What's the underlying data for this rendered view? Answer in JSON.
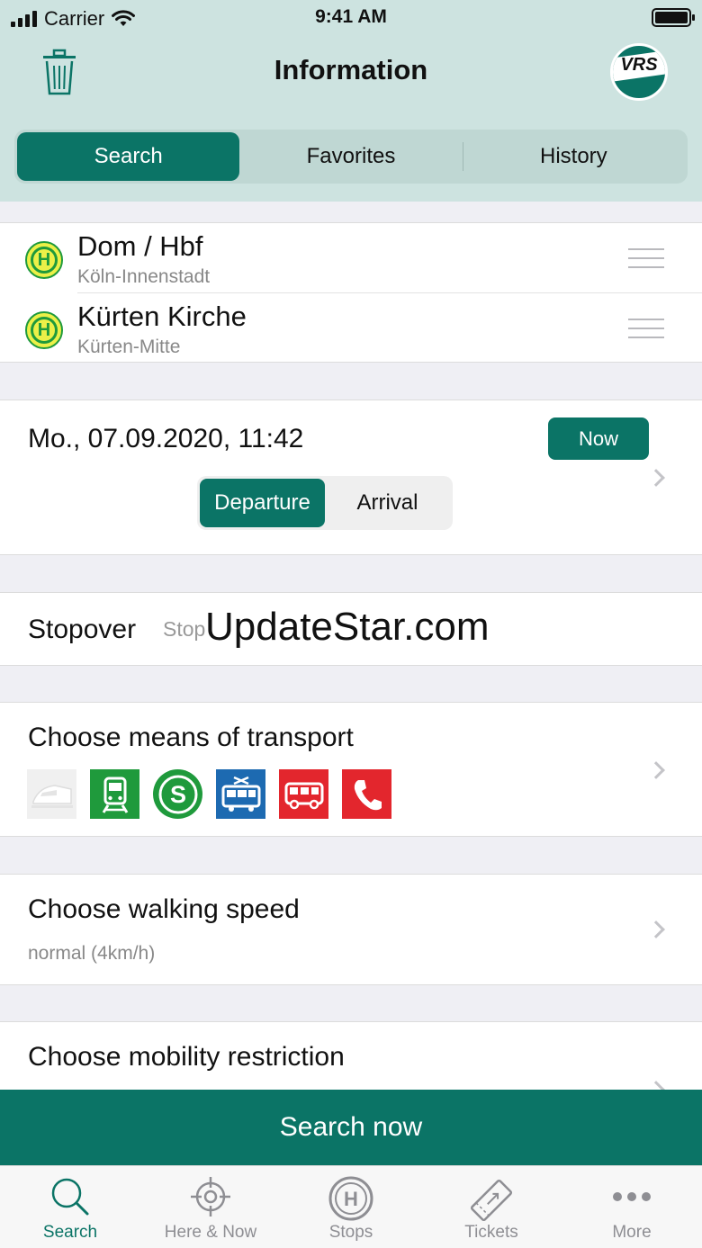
{
  "status_bar": {
    "carrier": "Carrier",
    "time": "9:41 AM"
  },
  "header": {
    "title": "Information",
    "logo_text": "VRS"
  },
  "segments": {
    "items": [
      "Search",
      "Favorites",
      "History"
    ],
    "selected": "Search"
  },
  "stops": [
    {
      "name": "Dom / Hbf",
      "district": "Köln-Innenstadt",
      "icon_text": "H"
    },
    {
      "name": "Kürten Kirche",
      "district": "Kürten-Mitte",
      "icon_text": "H"
    }
  ],
  "datetime": {
    "value": "Mo., 07.09.2020, 11:42",
    "now_label": "Now",
    "departure_label": "Departure",
    "arrival_label": "Arrival",
    "selected": "Departure"
  },
  "stopover": {
    "label": "Stopover",
    "placeholder": "Stop",
    "watermark": "UpdateStar.com"
  },
  "transport": {
    "label": "Choose means of transport",
    "modes": [
      {
        "icon": "high-speed-train-icon",
        "color": "#f0f0f0",
        "enabled": false
      },
      {
        "icon": "regional-train-icon",
        "color": "#1f9a3c",
        "enabled": true
      },
      {
        "icon": "s-bahn-icon",
        "color": "#1f9a3c",
        "enabled": true,
        "text": "S"
      },
      {
        "icon": "tram-icon",
        "color": "#1d6ab1",
        "enabled": true
      },
      {
        "icon": "bus-icon",
        "color": "#e3262d",
        "enabled": true
      },
      {
        "icon": "on-demand-phone-icon",
        "color": "#e3262d",
        "enabled": true
      }
    ]
  },
  "walking": {
    "label": "Choose walking speed",
    "value": "normal (4km/h)"
  },
  "mobility": {
    "label": "Choose mobility restriction"
  },
  "search_button": {
    "label": "Search now"
  },
  "tabbar": {
    "items": [
      {
        "label": "Search",
        "icon": "magnifier-icon",
        "active": true
      },
      {
        "label": "Here & Now",
        "icon": "crosshair-icon",
        "active": false
      },
      {
        "label": "Stops",
        "icon": "stop-h-icon",
        "active": false
      },
      {
        "label": "Tickets",
        "icon": "ticket-icon",
        "active": false
      },
      {
        "label": "More",
        "icon": "more-dots-icon",
        "active": false
      }
    ]
  },
  "colors": {
    "primary": "#0b7466",
    "header_bg": "#cde3e0",
    "stop_icon_yellow": "#ecf048",
    "stop_icon_green": "#1f9a3c"
  }
}
